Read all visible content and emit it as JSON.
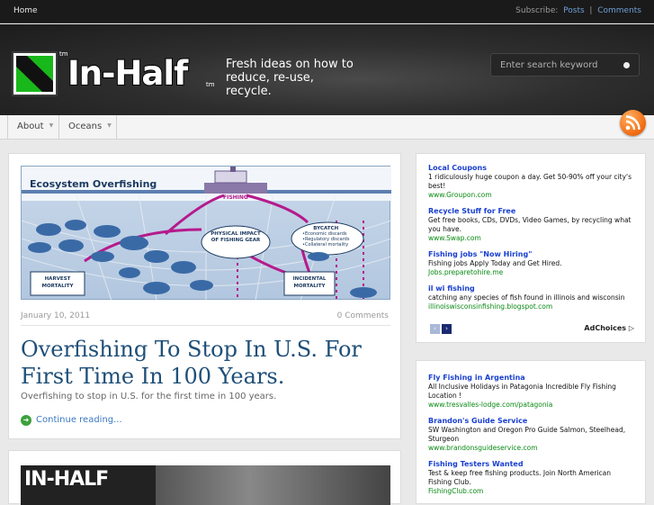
{
  "topbar": {
    "home": "Home",
    "subscribe_label": "Subscribe:",
    "posts": "Posts",
    "separator": "|",
    "comments": "Comments"
  },
  "header": {
    "logo_text": "In-Half",
    "tm": "tm",
    "tagline": "Fresh ideas on how to reduce, re-use, recycle.",
    "search_placeholder": "Enter search keyword"
  },
  "nav": {
    "items": [
      {
        "label": "About"
      },
      {
        "label": "Oceans"
      }
    ]
  },
  "post1": {
    "image_title": "Ecosystem Overfishing",
    "diagram": {
      "fishing": "FISHING",
      "impact": "PHYSICAL IMPACT OF FISHING GEAR",
      "bycatch": "BYCATCH",
      "bycatch_items": [
        "•Economic discards",
        "•Regulatory discards",
        "•Collateral mortality"
      ],
      "harvest": "HARVEST MORTALITY",
      "incidental": "INCIDENTAL MORTALITY"
    },
    "date": "January 10, 2011",
    "comments": "0 Comments",
    "title": "Overfishing To Stop In U.S. For First Time In 100 Years.",
    "excerpt": "Overfishing to stop in U.S. for the first time in 100 years.",
    "read_more": "Continue reading..."
  },
  "post2": {
    "image_text": "IN-HALF"
  },
  "ads1": {
    "items": [
      {
        "headline": "Local Coupons",
        "desc": "1 ridiculously huge coupon a day. Get 50-90% off your city's best!",
        "url": "www.Groupon.com"
      },
      {
        "headline": "Recycle Stuff for Free",
        "desc": "Get free books, CDs, DVDs, Video Games, by recycling what you have.",
        "url": "www.Swap.com"
      },
      {
        "headline": "Fishing jobs \"Now Hiring\"",
        "desc": "Fishing jobs Apply Today and Get Hired.",
        "url": "Jobs.preparetohire.me"
      },
      {
        "headline": "il wi fishing",
        "desc": "catching any species of fish found in illinois and wisconsin",
        "url": "illinoiswisconsinfishing.blogspot.com"
      }
    ],
    "prev": "‹",
    "next": "›",
    "adchoices": "AdChoices ▷"
  },
  "ads2": {
    "items": [
      {
        "headline": "Fly Fishing in Argentina",
        "desc": "All Inclusive Holidays in Patagonia Incredible Fly Fishing Location !",
        "url": "www.tresvalles-lodge.com/patagonia"
      },
      {
        "headline": "Brandon's Guide Service",
        "desc": "SW Washington and Oregon Pro Guide Salmon, Steelhead, Sturgeon",
        "url": "www.brandonsguideservice.com"
      },
      {
        "headline": "Fishing Testers Wanted",
        "desc": "Test & keep free fishing products. Join North American Fishing Club.",
        "url": "FishingClub.com"
      }
    ]
  },
  "colors": {
    "accent_link": "#3b78c2",
    "title_blue": "#1f4f78",
    "logo_green": "#19b81a",
    "rss_orange": "#f06a10"
  }
}
